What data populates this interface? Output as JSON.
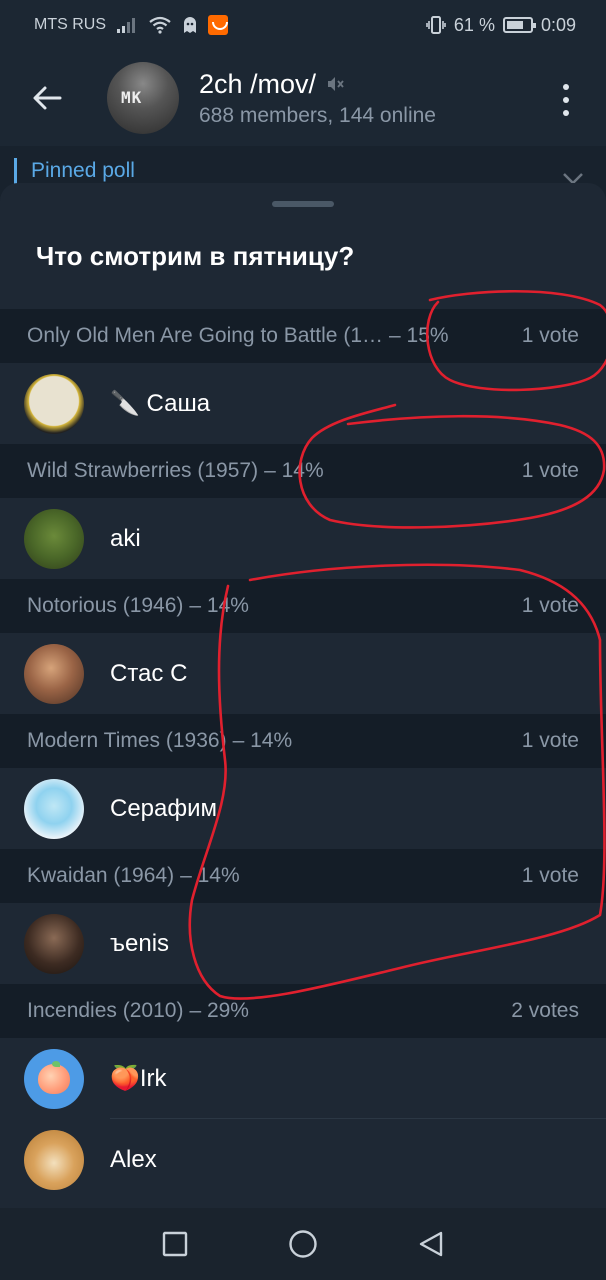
{
  "status_bar": {
    "carrier": "MTS RUS",
    "battery_percent": "61 %",
    "time": "0:09",
    "icons": [
      "signal-icon",
      "wifi-icon",
      "ghost-icon",
      "aliexpress-icon",
      "vibrate-icon",
      "battery-icon"
    ]
  },
  "header": {
    "title": "2ch /mov/",
    "subtitle": "688 members, 144 online",
    "avatar_text": "MK",
    "muted": true
  },
  "pinned": {
    "label": "Pinned poll"
  },
  "poll": {
    "question": "Что смотрим в пятницу?",
    "options": [
      {
        "name": "Only Old Men Are Going to Battle (1…",
        "percent": "– 15%",
        "votes": "1 vote",
        "voters": [
          {
            "name": "🔪 Саша"
          }
        ]
      },
      {
        "name": "Wild Strawberries (1957)",
        "percent": "– 14%",
        "votes": "1 vote",
        "voters": [
          {
            "name": "aki"
          }
        ]
      },
      {
        "name": "Notorious (1946)",
        "percent": "– 14%",
        "votes": "1 vote",
        "voters": [
          {
            "name": "Стас С"
          }
        ]
      },
      {
        "name": "Modern Times (1936)",
        "percent": "– 14%",
        "votes": "1 vote",
        "voters": [
          {
            "name": "Серафим"
          }
        ]
      },
      {
        "name": "Kwaidan (1964)",
        "percent": "– 14%",
        "votes": "1 vote",
        "voters": [
          {
            "name": "ъenis"
          }
        ]
      },
      {
        "name": "Incendies (2010)",
        "percent": "– 29%",
        "votes": "2 votes",
        "voters": [
          {
            "name": "🍑Irk"
          },
          {
            "name": "Alex"
          }
        ]
      }
    ]
  },
  "colors": {
    "accent": "#5aa9e6",
    "background": "#1e2834",
    "header_row": "#141d27",
    "annotation": "#e0202e"
  }
}
